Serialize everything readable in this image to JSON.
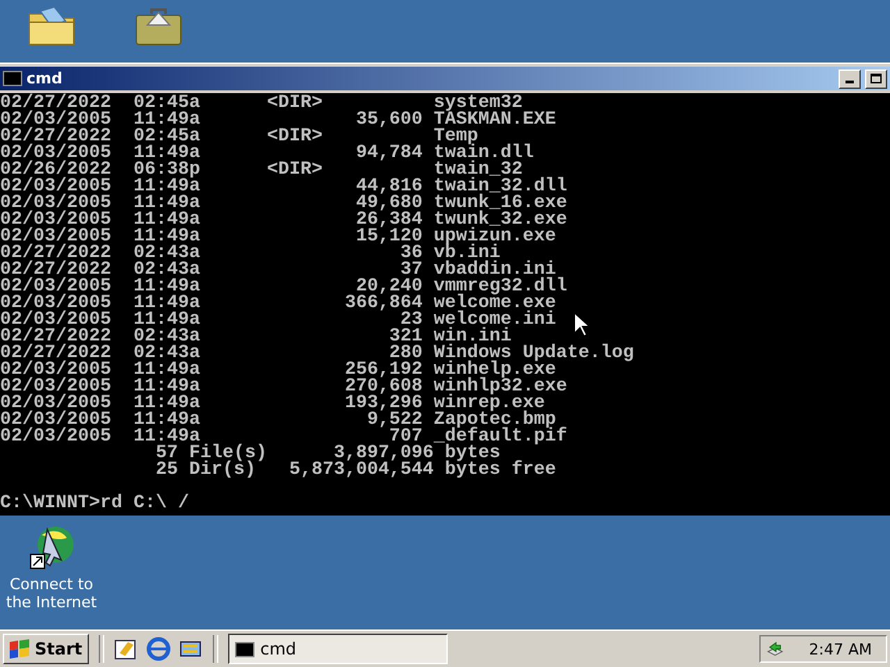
{
  "window": {
    "title": "cmd"
  },
  "console": {
    "rows": [
      {
        "date": "02/27/2022",
        "time": "02:45a",
        "kind": "dir",
        "size": "<DIR>",
        "name": "system32"
      },
      {
        "date": "02/03/2005",
        "time": "11:49a",
        "kind": "file",
        "size": "35,600",
        "name": "TASKMAN.EXE"
      },
      {
        "date": "02/27/2022",
        "time": "02:45a",
        "kind": "dir",
        "size": "<DIR>",
        "name": "Temp"
      },
      {
        "date": "02/03/2005",
        "time": "11:49a",
        "kind": "file",
        "size": "94,784",
        "name": "twain.dll"
      },
      {
        "date": "02/26/2022",
        "time": "06:38p",
        "kind": "dir",
        "size": "<DIR>",
        "name": "twain_32"
      },
      {
        "date": "02/03/2005",
        "time": "11:49a",
        "kind": "file",
        "size": "44,816",
        "name": "twain_32.dll"
      },
      {
        "date": "02/03/2005",
        "time": "11:49a",
        "kind": "file",
        "size": "49,680",
        "name": "twunk_16.exe"
      },
      {
        "date": "02/03/2005",
        "time": "11:49a",
        "kind": "file",
        "size": "26,384",
        "name": "twunk_32.exe"
      },
      {
        "date": "02/03/2005",
        "time": "11:49a",
        "kind": "file",
        "size": "15,120",
        "name": "upwizun.exe"
      },
      {
        "date": "02/27/2022",
        "time": "02:43a",
        "kind": "file",
        "size": "36",
        "name": "vb.ini"
      },
      {
        "date": "02/27/2022",
        "time": "02:43a",
        "kind": "file",
        "size": "37",
        "name": "vbaddin.ini"
      },
      {
        "date": "02/03/2005",
        "time": "11:49a",
        "kind": "file",
        "size": "20,240",
        "name": "vmmreg32.dll"
      },
      {
        "date": "02/03/2005",
        "time": "11:49a",
        "kind": "file",
        "size": "366,864",
        "name": "welcome.exe"
      },
      {
        "date": "02/03/2005",
        "time": "11:49a",
        "kind": "file",
        "size": "23",
        "name": "welcome.ini"
      },
      {
        "date": "02/27/2022",
        "time": "02:43a",
        "kind": "file",
        "size": "321",
        "name": "win.ini"
      },
      {
        "date": "02/27/2022",
        "time": "02:43a",
        "kind": "file",
        "size": "280",
        "name": "Windows Update.log"
      },
      {
        "date": "02/03/2005",
        "time": "11:49a",
        "kind": "file",
        "size": "256,192",
        "name": "winhelp.exe"
      },
      {
        "date": "02/03/2005",
        "time": "11:49a",
        "kind": "file",
        "size": "270,608",
        "name": "winhlp32.exe"
      },
      {
        "date": "02/03/2005",
        "time": "11:49a",
        "kind": "file",
        "size": "193,296",
        "name": "winrep.exe"
      },
      {
        "date": "02/03/2005",
        "time": "11:49a",
        "kind": "file",
        "size": "9,522",
        "name": "Zapotec.bmp"
      },
      {
        "date": "02/03/2005",
        "time": "11:49a",
        "kind": "file",
        "size": "707",
        "name": "_default.pif"
      }
    ],
    "summary": [
      {
        "count": "57 File(s)",
        "amount": "3,897,096",
        "unit": "bytes"
      },
      {
        "count": "25 Dir(s)",
        "amount": "5,873,004,544",
        "unit": "bytes free"
      }
    ],
    "prompt": "C:\\WINNT>rd C:\\ /"
  },
  "desktop_icons": [
    {
      "label": "Connect to the Internet"
    }
  ],
  "taskbar": {
    "start": "Start",
    "tasks": [
      {
        "label": "cmd",
        "selected": true
      }
    ],
    "clock": "2:47 AM"
  }
}
